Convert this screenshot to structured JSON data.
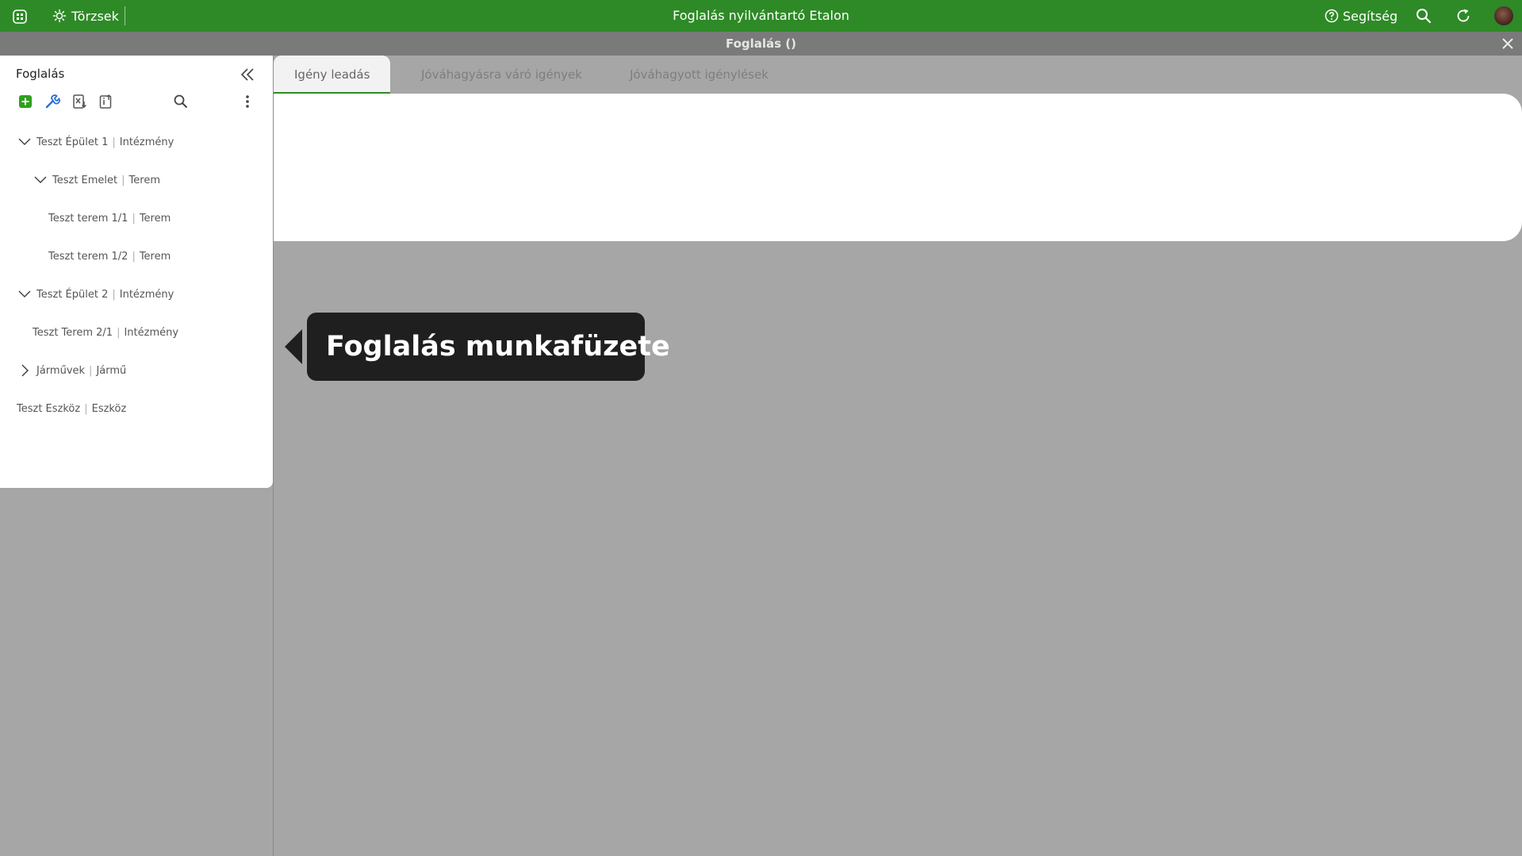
{
  "topbar": {
    "bg_color": "#2e8a26",
    "apps_icon": "apps-grid-icon",
    "torzsek_label": "Törzsek",
    "title": "Foglalás nyilvántartó Etalon",
    "help_label": "Segítség",
    "search_icon": "search-icon",
    "refresh_icon": "refresh-icon",
    "avatar": "user-avatar"
  },
  "subbar": {
    "title": "Foglalás ()",
    "close_icon": "close-icon"
  },
  "left_panel": {
    "title": "Foglalás",
    "collapse_icon": "double-chevron-left-icon",
    "toolbar": {
      "add_icon": "add-icon",
      "settings_icon": "wrench-icon",
      "excel_export_icon": "excel-export-icon",
      "info_icon": "info-icon",
      "search_icon": "search-icon",
      "more_icon": "more-vertical-icon"
    },
    "tree": [
      {
        "name": "Teszt Épület 1",
        "type": "Intézmény",
        "expanded": true
      },
      {
        "name": "Teszt Emelet",
        "type": "Terem",
        "expanded": true
      },
      {
        "name": "Teszt terem 1/1",
        "type": "Terem"
      },
      {
        "name": "Teszt terem 1/2",
        "type": "Terem"
      },
      {
        "name": "Teszt Épület 2",
        "type": "Intézmény",
        "expanded": true
      },
      {
        "name": "Teszt Terem 2/1",
        "type": "Intézmény"
      },
      {
        "name": "Járművek",
        "type": "Jármű",
        "expanded": false
      },
      {
        "name": "Teszt Eszköz",
        "type": "Eszköz"
      }
    ]
  },
  "tabs": [
    {
      "label": "Igény leadás",
      "active": true
    },
    {
      "label": "Jóváhagyásra váró igények",
      "active": false
    },
    {
      "label": "Jóváhagyott igénylések",
      "active": false
    }
  ],
  "tooltip": {
    "text": "Foglalás munkafüzete"
  }
}
